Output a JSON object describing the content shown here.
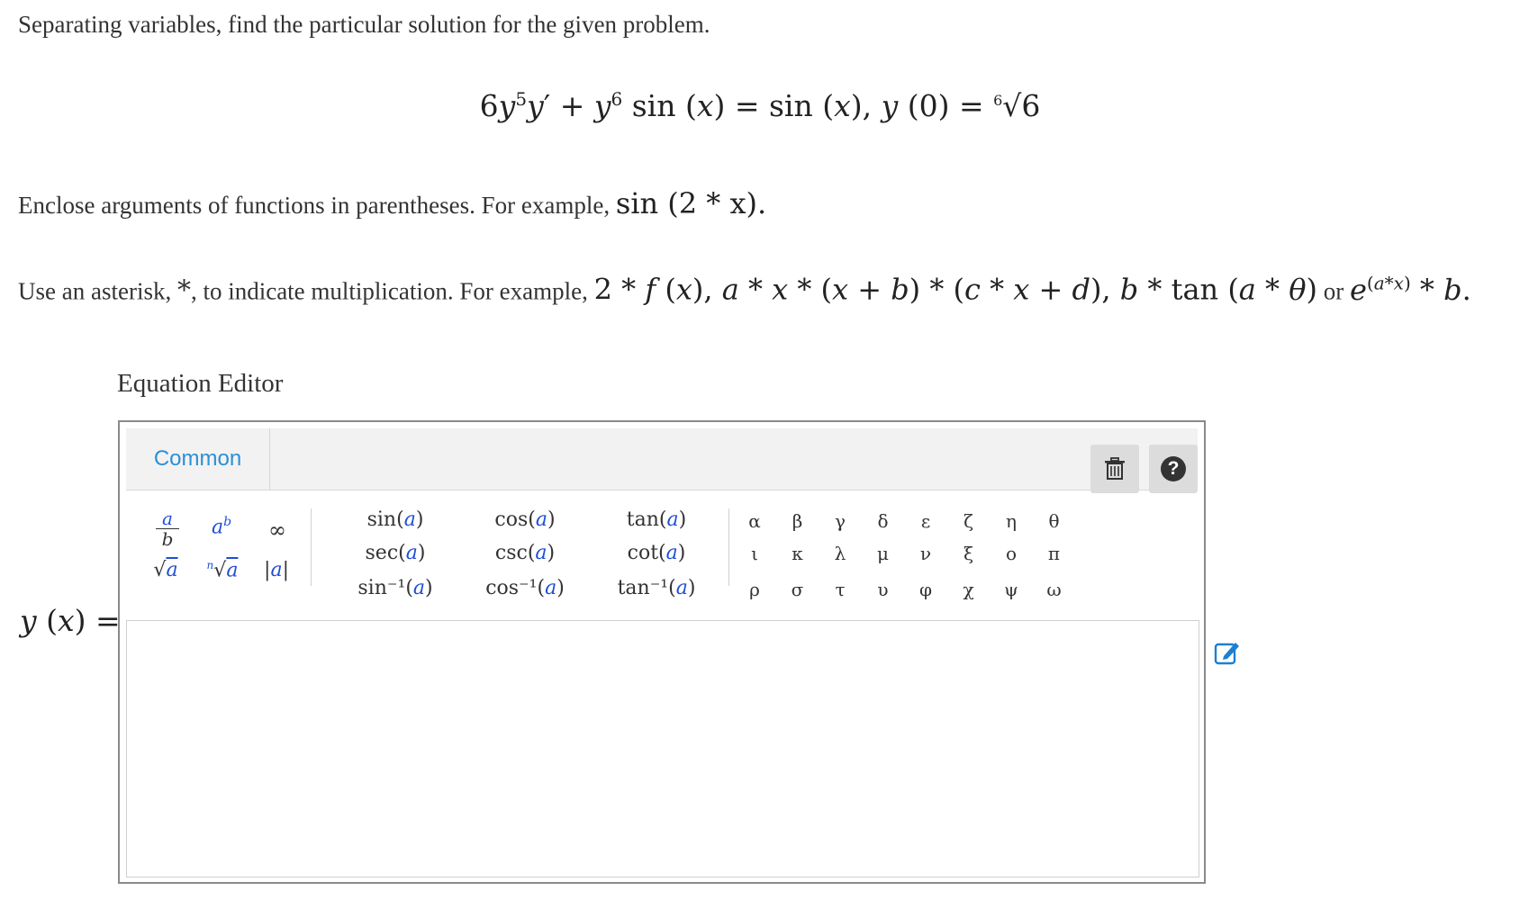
{
  "prompt": {
    "instruction": "Separating variables, find the particular solution for the given problem.",
    "paren_note": "Enclose arguments of functions in parentheses. For example,",
    "paren_example": "sin (2 * x).",
    "asterisk_note_1": "Use an asterisk,",
    "asterisk_note_2": ", to indicate multiplication. For example,",
    "or_word": "or"
  },
  "editor": {
    "title": "Equation Editor",
    "tab_label": "Common",
    "trash_icon": "trash-icon",
    "help_icon": "help-icon",
    "help_glyph": "?",
    "answer_label": "y (x) =",
    "answer_value": "",
    "templates": {
      "fraction": "a/b",
      "power": "a^b",
      "infinity": "∞",
      "sqrt": "√a",
      "nthroot": "ⁿ√a",
      "abs": "|a|"
    },
    "functions": [
      [
        "sin",
        "cos",
        "tan"
      ],
      [
        "sec",
        "csc",
        "cot"
      ],
      [
        "sin⁻¹",
        "cos⁻¹",
        "tan⁻¹"
      ]
    ],
    "function_arg": "a",
    "greek": [
      [
        "α",
        "β",
        "γ",
        "δ",
        "ε",
        "ζ",
        "η",
        "θ"
      ],
      [
        "ι",
        "κ",
        "λ",
        "μ",
        "ν",
        "ξ",
        "ο",
        "π"
      ],
      [
        "ρ",
        "σ",
        "τ",
        "υ",
        "φ",
        "χ",
        "ψ",
        "ω"
      ]
    ]
  },
  "colors": {
    "tab": "#2b8fd6",
    "variable": "#1f4fd6",
    "edit_icon": "#1e7fd0"
  }
}
